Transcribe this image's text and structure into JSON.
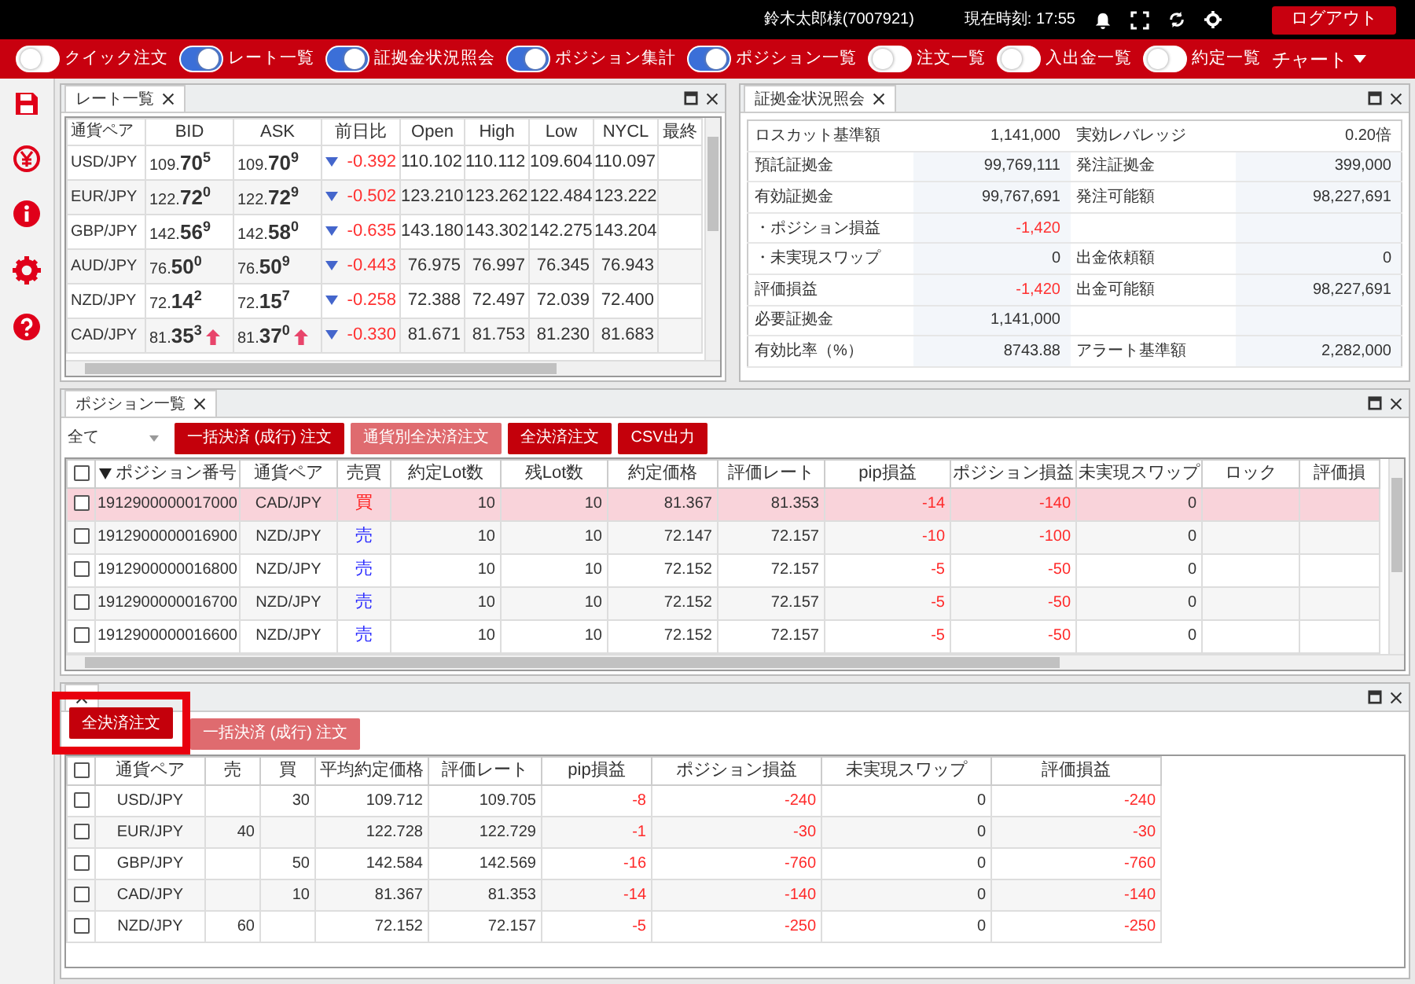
{
  "header": {
    "user": "鈴木太郎様(7007921)",
    "clock": "現在時刻: 17:55",
    "logout": "ログアウト"
  },
  "toggles": [
    {
      "label": "クイック注文",
      "on": false
    },
    {
      "label": "レート一覧",
      "on": true
    },
    {
      "label": "証拠金状況照会",
      "on": true
    },
    {
      "label": "ポジション集計",
      "on": true
    },
    {
      "label": "ポジション一覧",
      "on": true
    },
    {
      "label": "注文一覧",
      "on": false
    },
    {
      "label": "入出金一覧",
      "on": false
    },
    {
      "label": "約定一覧",
      "on": false
    }
  ],
  "chart_menu": "チャート",
  "rates": {
    "title": "レート一覧",
    "columns": [
      "通貨ペア",
      "BID",
      "ASK",
      "前日比",
      "Open",
      "High",
      "Low",
      "NYCL",
      "最終"
    ],
    "rows": [
      {
        "pair": "USD/JPY",
        "bid": {
          "base": "109.",
          "pips": "70",
          "frac": "5",
          "up": false
        },
        "ask": {
          "base": "109.",
          "pips": "70",
          "frac": "9",
          "up": false
        },
        "falling": true,
        "change": "-0.392",
        "open": "110.102",
        "high": "110.112",
        "low": "109.604",
        "nycl": "110.097"
      },
      {
        "pair": "EUR/JPY",
        "bid": {
          "base": "122.",
          "pips": "72",
          "frac": "0",
          "up": false
        },
        "ask": {
          "base": "122.",
          "pips": "72",
          "frac": "9",
          "up": false
        },
        "falling": true,
        "change": "-0.502",
        "open": "123.210",
        "high": "123.262",
        "low": "122.484",
        "nycl": "123.222"
      },
      {
        "pair": "GBP/JPY",
        "bid": {
          "base": "142.",
          "pips": "56",
          "frac": "9",
          "up": false
        },
        "ask": {
          "base": "142.",
          "pips": "58",
          "frac": "0",
          "up": false
        },
        "falling": true,
        "change": "-0.635",
        "open": "143.180",
        "high": "143.302",
        "low": "142.275",
        "nycl": "143.204"
      },
      {
        "pair": "AUD/JPY",
        "bid": {
          "base": "76.",
          "pips": "50",
          "frac": "0",
          "up": false
        },
        "ask": {
          "base": "76.",
          "pips": "50",
          "frac": "9",
          "up": false
        },
        "falling": true,
        "change": "-0.443",
        "open": "76.975",
        "high": "76.997",
        "low": "76.345",
        "nycl": "76.943"
      },
      {
        "pair": "NZD/JPY",
        "bid": {
          "base": "72.",
          "pips": "14",
          "frac": "2",
          "up": false
        },
        "ask": {
          "base": "72.",
          "pips": "15",
          "frac": "7",
          "up": false
        },
        "falling": true,
        "change": "-0.258",
        "open": "72.388",
        "high": "72.497",
        "low": "72.039",
        "nycl": "72.400"
      },
      {
        "pair": "CAD/JPY",
        "bid": {
          "base": "81.",
          "pips": "35",
          "frac": "3",
          "up": true
        },
        "ask": {
          "base": "81.",
          "pips": "37",
          "frac": "0",
          "up": true
        },
        "falling": true,
        "change": "-0.330",
        "open": "81.671",
        "high": "81.753",
        "low": "81.230",
        "nycl": "81.683"
      }
    ]
  },
  "margin": {
    "title": "証拠金状況照会",
    "rows": [
      {
        "left": {
          "label": "ロスカット基準額",
          "value": "1,141,000",
          "loss": false
        },
        "right": {
          "label": "実効レバレッジ",
          "value": "0.20倍"
        }
      },
      {
        "left": {
          "label": "預託証拠金",
          "value": "99,769,111",
          "loss": false
        },
        "right": {
          "label": "発注証拠金",
          "value": "399,000"
        }
      },
      {
        "left": {
          "label": "有効証拠金",
          "value": "99,767,691",
          "loss": false
        },
        "right": {
          "label": "発注可能額",
          "value": "98,227,691"
        }
      },
      {
        "left": {
          "label": "・ポジション損益",
          "value": "-1,420",
          "loss": true
        }
      },
      {
        "left": {
          "label": "・未実現スワップ",
          "value": "0",
          "loss": false
        },
        "right": {
          "label": "出金依頼額",
          "value": "0"
        }
      },
      {
        "left": {
          "label": "評価損益",
          "value": "-1,420",
          "loss": true
        },
        "right": {
          "label": "出金可能額",
          "value": "98,227,691"
        }
      },
      {
        "left": {
          "label": "必要証拠金",
          "value": "1,141,000",
          "loss": false
        }
      },
      {
        "left": {
          "label": "有効比率（%）",
          "value": "8743.88",
          "loss": false
        },
        "right": {
          "label": "アラート基準額",
          "value": "2,282,000"
        }
      }
    ]
  },
  "positions": {
    "title": "ポジション一覧",
    "filter": "全て",
    "buttons": [
      {
        "label": "一括決済 (成行) 注文",
        "disabled": false
      },
      {
        "label": "通貨別全決済注文",
        "disabled": true
      },
      {
        "label": "全決済注文",
        "disabled": false
      },
      {
        "label": "CSV出力",
        "disabled": false
      }
    ],
    "all_checked": false,
    "columns": [
      {
        "label": "ポジション番号",
        "descending": true,
        "kind": "text"
      },
      {
        "label": "通貨ペア",
        "kind": "text"
      },
      {
        "label": "売買",
        "kind": "side"
      },
      {
        "label": "約定Lot数",
        "kind": "num"
      },
      {
        "label": "残Lot数",
        "kind": "num"
      },
      {
        "label": "約定価格",
        "kind": "num"
      },
      {
        "label": "評価レート",
        "kind": "num"
      },
      {
        "label": "pip損益",
        "kind": "loss"
      },
      {
        "label": "ポジション損益",
        "kind": "loss"
      },
      {
        "label": "未実現スワップ",
        "kind": "num"
      },
      {
        "label": "ロック"
      },
      {
        "label": "評価損"
      }
    ],
    "rows": [
      {
        "selected": true,
        "checked": false,
        "buy": true,
        "cells": [
          "1912900000017000",
          "CAD/JPY",
          "買",
          "10",
          "10",
          "81.367",
          "81.353",
          "-14",
          "-140",
          "0"
        ]
      },
      {
        "selected": false,
        "checked": false,
        "buy": false,
        "cells": [
          "1912900000016900",
          "NZD/JPY",
          "売",
          "10",
          "10",
          "72.147",
          "72.157",
          "-10",
          "-100",
          "0"
        ]
      },
      {
        "selected": false,
        "checked": false,
        "buy": false,
        "cells": [
          "1912900000016800",
          "NZD/JPY",
          "売",
          "10",
          "10",
          "72.152",
          "72.157",
          "-5",
          "-50",
          "0"
        ]
      },
      {
        "selected": false,
        "checked": false,
        "buy": false,
        "cells": [
          "1912900000016700",
          "NZD/JPY",
          "売",
          "10",
          "10",
          "72.152",
          "72.157",
          "-5",
          "-50",
          "0"
        ]
      },
      {
        "selected": false,
        "checked": false,
        "buy": false,
        "cells": [
          "1912900000016600",
          "NZD/JPY",
          "売",
          "10",
          "10",
          "72.152",
          "72.157",
          "-5",
          "-50",
          "0"
        ]
      }
    ]
  },
  "summary": {
    "buttons": [
      {
        "label": "全決済注文",
        "disabled": false,
        "highlighted": true
      },
      {
        "label": "一括決済 (成行) 注文",
        "disabled": true,
        "highlighted": false
      }
    ],
    "all_checked": false,
    "columns": [
      {
        "label": "通貨ペア",
        "kind": "text"
      },
      {
        "label": "売",
        "kind": "num"
      },
      {
        "label": "買",
        "kind": "num"
      },
      {
        "label": "平均約定価格",
        "kind": "num"
      },
      {
        "label": "評価レート",
        "kind": "num"
      },
      {
        "label": "pip損益",
        "kind": "loss"
      },
      {
        "label": "ポジション損益",
        "kind": "loss"
      },
      {
        "label": "未実現スワップ",
        "kind": "num"
      },
      {
        "label": "評価損益",
        "kind": "loss"
      }
    ],
    "rows": [
      {
        "checked": false,
        "cells": [
          "USD/JPY",
          null,
          "30",
          "109.712",
          "109.705",
          "-8",
          "-240",
          "0",
          "-240"
        ]
      },
      {
        "checked": false,
        "cells": [
          "EUR/JPY",
          "40",
          null,
          "122.728",
          "122.729",
          "-1",
          "-30",
          "0",
          "-30"
        ]
      },
      {
        "checked": false,
        "cells": [
          "GBP/JPY",
          null,
          "50",
          "142.584",
          "142.569",
          "-16",
          "-760",
          "0",
          "-760"
        ]
      },
      {
        "checked": false,
        "cells": [
          "CAD/JPY",
          null,
          "10",
          "81.367",
          "81.353",
          "-14",
          "-140",
          "0",
          "-140"
        ]
      },
      {
        "checked": false,
        "cells": [
          "NZD/JPY",
          "60",
          null,
          "72.152",
          "72.157",
          "-5",
          "-250",
          "0",
          "-250"
        ]
      }
    ]
  }
}
